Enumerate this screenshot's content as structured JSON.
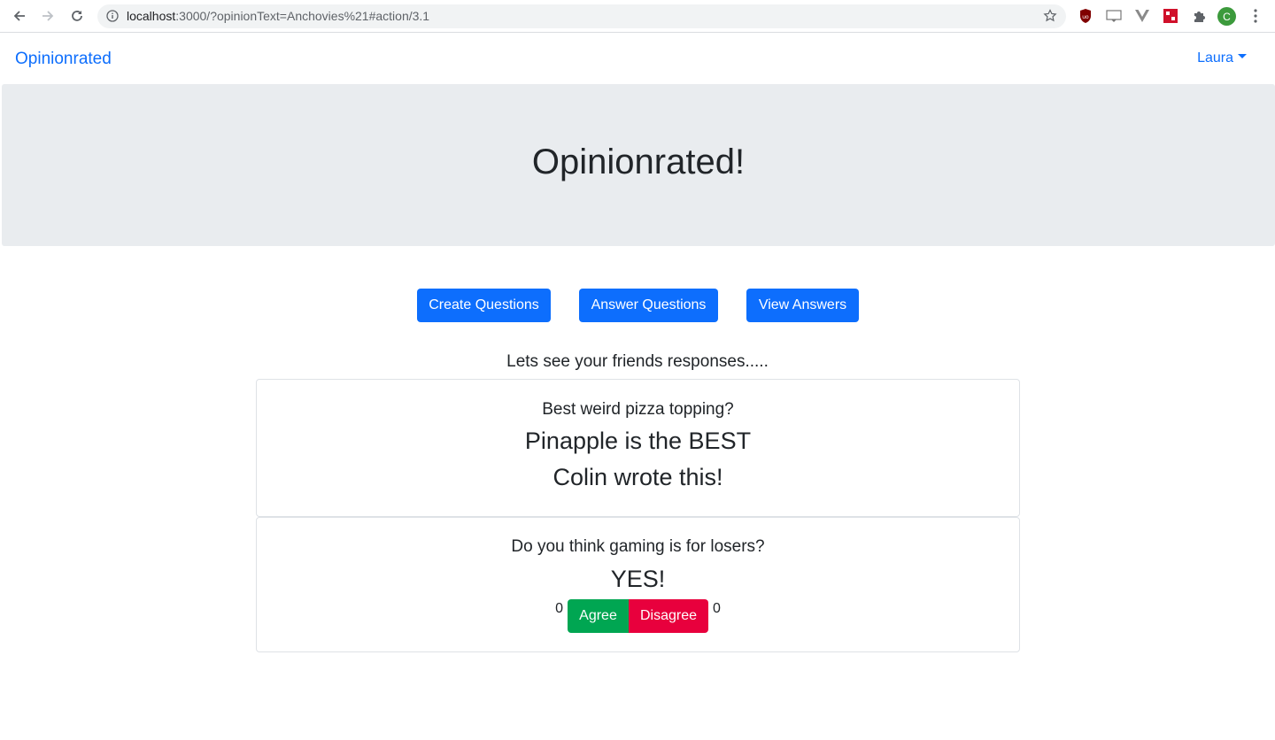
{
  "browser": {
    "url_host": "localhost",
    "url_rest": ":3000/?opinionText=Anchovies%21#action/3.1",
    "profile_initial": "C",
    "icons": [
      "back-icon",
      "forward-icon",
      "reload-icon",
      "info-icon",
      "star-icon",
      "ublock-icon",
      "extension-icon",
      "vue-icon",
      "extension-icon",
      "puzzle-icon",
      "kebab-icon"
    ]
  },
  "nav": {
    "brand": "Opinionrated",
    "user": "Laura"
  },
  "hero": {
    "title": "Opinionrated!"
  },
  "actions": {
    "create": "Create Questions",
    "answer": "Answer Questions",
    "view": "View Answers"
  },
  "feed": {
    "heading": "Lets see your friends responses.....",
    "cards": [
      {
        "question": "Best weird pizza topping?",
        "answer": "Pinapple is the BEST",
        "author": "Colin wrote this!"
      },
      {
        "question": "Do you think gaming is for losers?",
        "answer": "YES!",
        "agree_count": "0",
        "agree_label": "Agree",
        "disagree_label": "Disagree",
        "disagree_count": "0"
      }
    ]
  },
  "colors": {
    "primary": "#0d6efd",
    "success": "#00a652",
    "danger": "#e8003d",
    "jumbotron": "#e9ecef"
  }
}
